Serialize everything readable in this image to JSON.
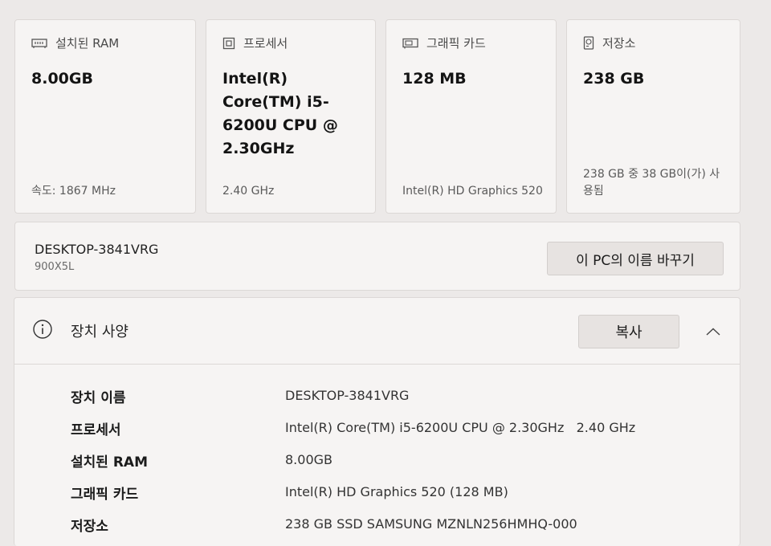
{
  "cards": {
    "ram": {
      "title": "설치된 RAM",
      "value": "8.00GB",
      "sub": "속도: 1867 MHz",
      "icon": "ram-icon"
    },
    "processor": {
      "title": "프로세서",
      "value": "Intel(R) Core(TM) i5-6200U CPU @ 2.30GHz",
      "sub": "2.40 GHz",
      "icon": "processor-icon"
    },
    "graphics": {
      "title": "그래픽 카드",
      "value": "128 MB",
      "sub": "Intel(R) HD Graphics 520",
      "icon": "graphics-card-icon"
    },
    "storage": {
      "title": "저장소",
      "value": "238 GB",
      "sub": "238 GB 중 38 GB이(가) 사용됨",
      "icon": "storage-icon"
    }
  },
  "pc": {
    "name": "DESKTOP-3841VRG",
    "model": "900X5L",
    "rename_label": "이 PC의 이름 바꾸기"
  },
  "device_specs": {
    "title": "장치 사양",
    "copy_label": "복사",
    "rows": [
      {
        "label": "장치 이름",
        "value": "DESKTOP-3841VRG"
      },
      {
        "label": "프로세서",
        "value": "Intel(R) Core(TM) i5-6200U CPU @ 2.30GHz   2.40 GHz"
      },
      {
        "label": "설치된 RAM",
        "value": "8.00GB"
      },
      {
        "label": "그래픽 카드",
        "value": "Intel(R) HD Graphics 520 (128 MB)"
      },
      {
        "label": "저장소",
        "value": "238 GB SSD SAMSUNG MZNLN256HMHQ-000"
      }
    ]
  }
}
